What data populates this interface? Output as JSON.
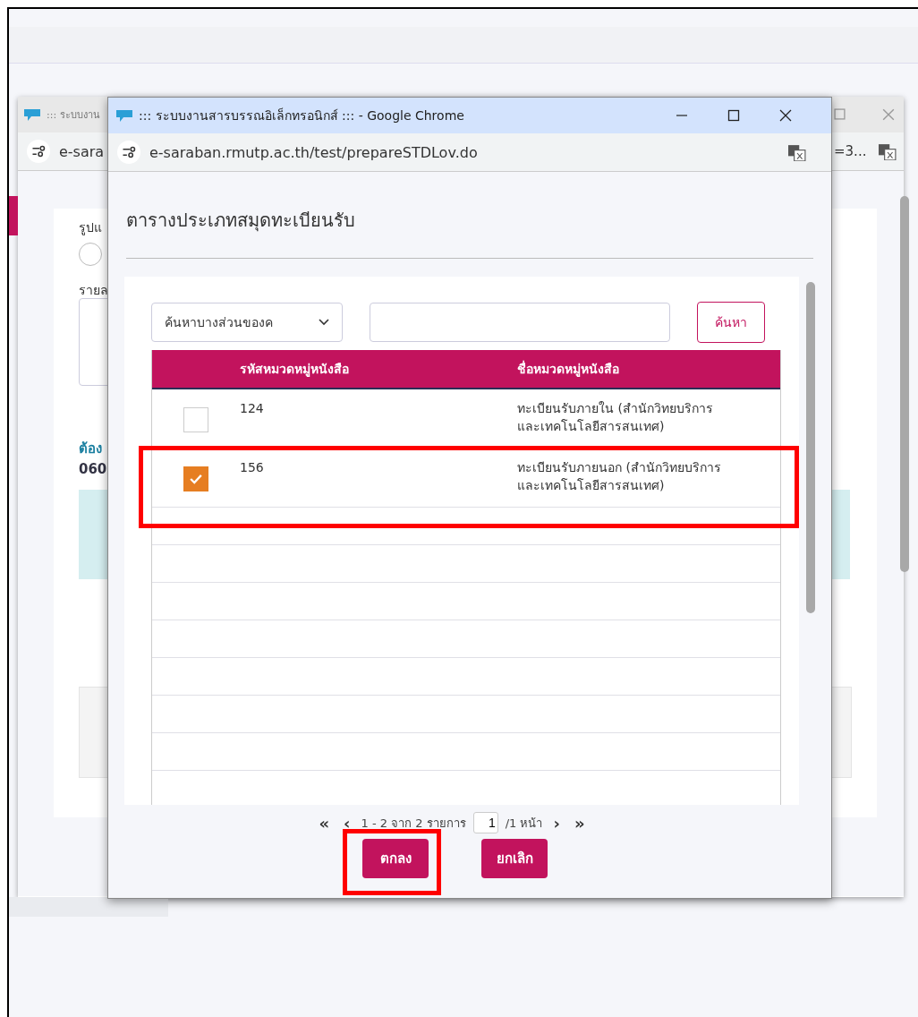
{
  "background_window": {
    "title": "::: ระบบงาน",
    "address": "e-sara",
    "address_tail": "=3...",
    "form": {
      "label_1": "รูปแ",
      "radio_selected": false,
      "label_2": "รายล",
      "link": "ต้อง",
      "value": "060"
    }
  },
  "dialog": {
    "title": "::: ระบบงานสารบรรณอิเล็กทรอนิกส์ ::: - Google Chrome",
    "address": "e-saraban.rmutp.ac.th/test/prepareSTDLov.do",
    "heading": "ตารางประเภทสมุดทะเบียนรับ",
    "search": {
      "mode": "ค้นหาบางส่วนของค",
      "button": "ค้นหา"
    },
    "table": {
      "columns": [
        "รหัสหมวดหมู่หนังสือ",
        "ชื่อหมวดหมู่หนังสือ"
      ],
      "rows": [
        {
          "code": "124",
          "name": "ทะเบียนรับภายใน (สำนักวิทยบริการและเทคโนโลยีสารสนเทศ)",
          "selected": false
        },
        {
          "code": "156",
          "name": "ทะเบียนรับภายนอก (สำนักวิทยบริการและเทคโนโลยีสารสนเทศ)",
          "selected": true
        }
      ]
    },
    "pager": {
      "first": "«",
      "prev": "‹",
      "summary": "1 - 2 จาก 2 รายการ",
      "page": "1",
      "pages": "/1 หน้า",
      "next": "›",
      "last": "»"
    },
    "buttons": [
      {
        "label": "ตกลง"
      },
      {
        "label": "ยกเลิก"
      }
    ]
  }
}
